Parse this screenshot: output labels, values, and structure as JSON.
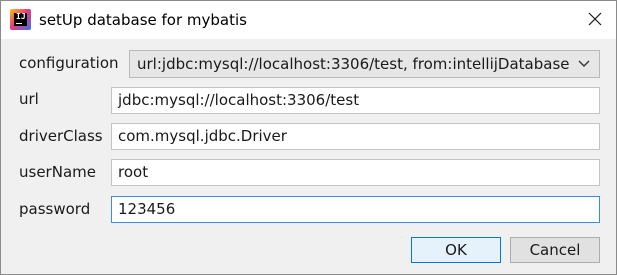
{
  "window": {
    "title": "setUp database for mybatis",
    "app_icon_text": "IJ"
  },
  "form": {
    "configuration": {
      "label": "configuration",
      "selected": "url:jdbc:mysql://localhost:3306/test, from:intellijDatabase"
    },
    "url": {
      "label": "url",
      "value": "jdbc:mysql://localhost:3306/test"
    },
    "driverClass": {
      "label": "driverClass",
      "value": "com.mysql.jdbc.Driver"
    },
    "userName": {
      "label": "userName",
      "value": "root"
    },
    "password": {
      "label": "password",
      "value": "123456"
    }
  },
  "buttons": {
    "ok_label": "OK",
    "cancel_label": "Cancel"
  },
  "colors": {
    "focus_border": "#3a8dde",
    "default_button_border": "#0078d7"
  }
}
